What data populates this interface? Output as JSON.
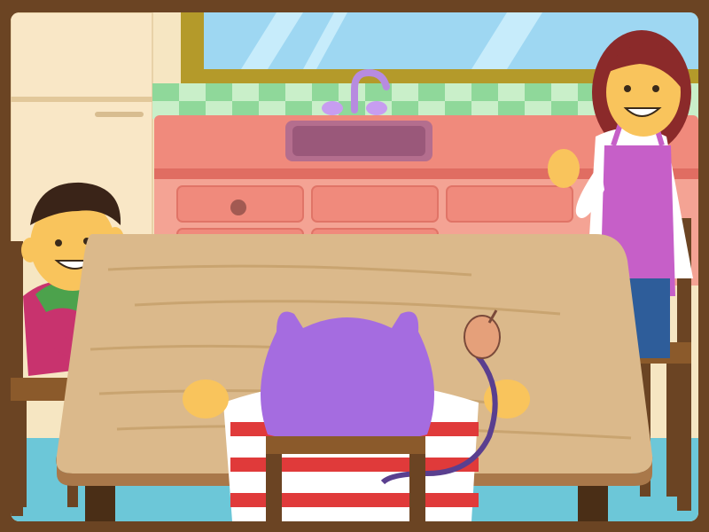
{
  "scene": {
    "colors": {
      "frame": "#6b4423",
      "wall": "#f6e6c2",
      "tile_green": "#8fd89a",
      "tile_light": "#c9efc9",
      "counter": "#f08a7c",
      "counter_dark": "#e06d62",
      "sink": "#b46e8e",
      "faucet": "#b78be0",
      "table": "#dbb98b",
      "table_edge": "#a9784a",
      "chair": "#6b4423",
      "window_frame": "#b49a2a",
      "window_glass": "#9ed7f2",
      "floor": "#6cc7d8",
      "fridge": "#f9e7c6"
    },
    "characters": [
      {
        "name": "boy",
        "shirt_color": "#c8336e",
        "sleeve_color": "#4ca24c"
      },
      {
        "name": "mother",
        "apron_color": "#c65fc8",
        "shirt_color": "#ffffff"
      },
      {
        "name": "purple-cat-player",
        "head_color": "#a56ce0",
        "shirt": "red-white-stripes"
      }
    ]
  }
}
